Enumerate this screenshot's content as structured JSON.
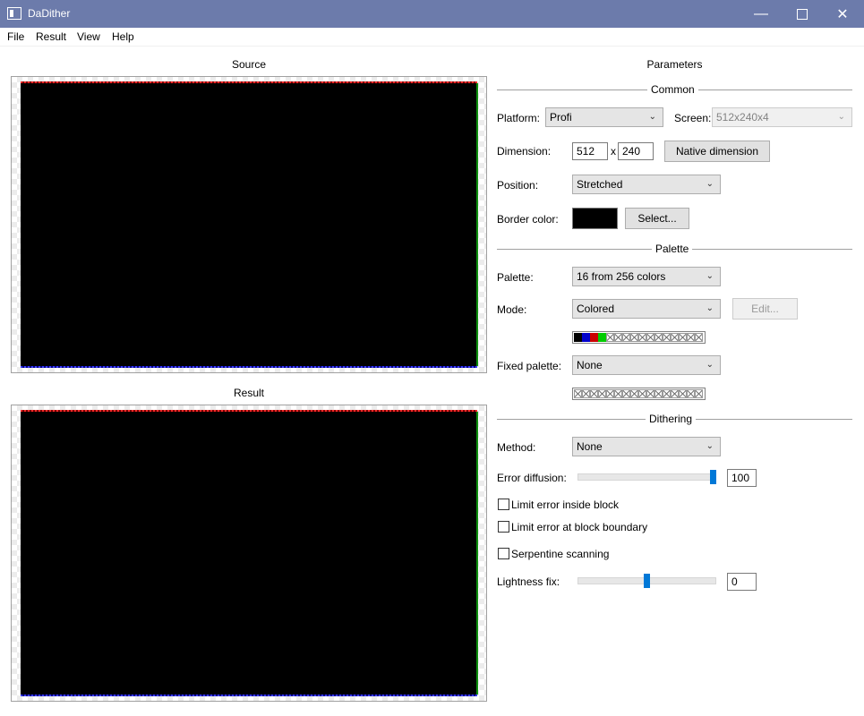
{
  "window": {
    "title": "DaDither"
  },
  "menu": {
    "file": "File",
    "result": "Result",
    "view": "View",
    "help": "Help"
  },
  "panels": {
    "source_title": "Source",
    "result_title": "Result",
    "parameters_title": "Parameters"
  },
  "common": {
    "header": "Common",
    "platform_label": "Platform:",
    "platform_value": "Profi",
    "screen_label": "Screen:",
    "screen_value": "512x240x4",
    "dimension_label": "Dimension:",
    "dim_width": "512",
    "dim_sep": "x",
    "dim_height": "240",
    "native_button": "Native dimension",
    "position_label": "Position:",
    "position_value": "Stretched",
    "border_color_label": "Border color:",
    "border_color": "#000000",
    "select_button": "Select..."
  },
  "palette": {
    "header": "Palette",
    "palette_label": "Palette:",
    "palette_value": "16 from 256 colors",
    "mode_label": "Mode:",
    "mode_value": "Colored",
    "edit_button": "Edit...",
    "swatch_colors": [
      "#000000",
      "#0000cc",
      "#cc0000",
      "#00cc00"
    ],
    "empty_swatches": 12,
    "fixed_label": "Fixed palette:",
    "fixed_value": "None",
    "fixed_empty_swatches": 16
  },
  "dithering": {
    "header": "Dithering",
    "method_label": "Method:",
    "method_value": "None",
    "error_diffusion_label": "Error diffusion:",
    "error_diffusion_value": "100",
    "error_diffusion_fraction": 1.0,
    "limit_inside_label": "Limit error inside block",
    "limit_boundary_label": "Limit error at block boundary",
    "serpentine_label": "Serpentine scanning",
    "lightness_label": "Lightness fix:",
    "lightness_value": "0",
    "lightness_fraction": 0.5
  },
  "colors": {
    "titlebar": "#6c7bab",
    "slider_thumb": "#0078d7"
  }
}
